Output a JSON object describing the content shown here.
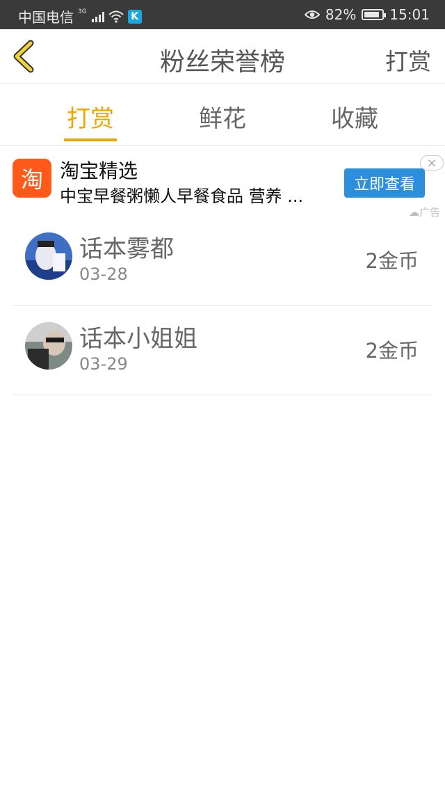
{
  "status_bar": {
    "carrier": "中国电信",
    "network": "3G",
    "battery": "82%",
    "battery_level": 0.82,
    "time": "15:01",
    "app_badge": "K"
  },
  "header": {
    "back_icon": "chevron-left-icon",
    "title": "粉丝荣誉榜",
    "action": "打赏"
  },
  "tabs": [
    {
      "label": "打赏",
      "active": true
    },
    {
      "label": "鲜花",
      "active": false
    },
    {
      "label": "收藏",
      "active": false
    }
  ],
  "ad": {
    "logo_text": "淘",
    "title": "淘宝精选",
    "description": "中宝早餐粥懒人早餐食品 营养 ...",
    "cta": "立即查看",
    "close": "×",
    "tag": "广告"
  },
  "rewards": [
    {
      "name": "话本雾都",
      "date": "03-28",
      "amount": "2金币"
    },
    {
      "name": "话本小姐姐",
      "date": "03-29",
      "amount": "2金币"
    }
  ],
  "colors": {
    "accent": "#f0a500",
    "status_bar": "#3a3a3a",
    "ad_button": "#2c8fdc",
    "taobao": "#ff5a1a"
  }
}
